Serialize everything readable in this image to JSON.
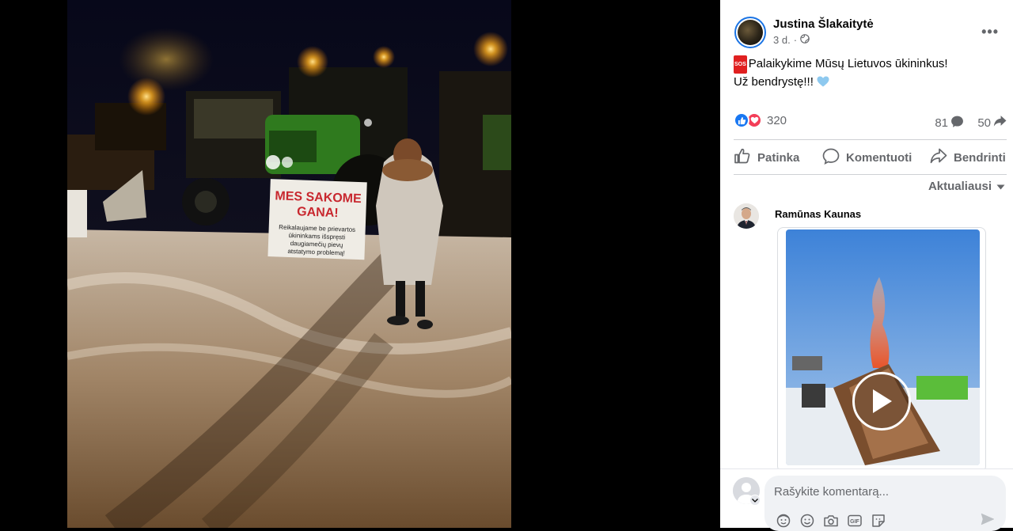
{
  "post": {
    "author": "Justina Šlakaitytė",
    "time": "3 d.",
    "privacy_icon": "globe-icon",
    "more_label": "•••",
    "sos_badge": "SOS",
    "text_line1": "Palaikykime Mūsų Lietuvos ūkininkus!",
    "text_line2": "Už bendrystę!!!",
    "reaction_count": "320",
    "comment_count": "81",
    "share_count": "50"
  },
  "photo": {
    "sign_line1": "MES SAKOME",
    "sign_line2": "GANA!",
    "sign_small1": "Reikalaujame be prievartos",
    "sign_small2": "ūkininkams išspręsti",
    "sign_small3": "daugiamečių pievų",
    "sign_small4": "atstatymo problemą!",
    "left_sign1": "MES",
    "left_sign2": "SAKOME"
  },
  "actions": {
    "like": "Patinka",
    "comment": "Komentuoti",
    "share": "Bendrinti"
  },
  "sort_label": "Aktualiausi",
  "comment": {
    "author": "Ramūnas Kaunas"
  },
  "composer": {
    "placeholder": "Rašykite komentarą..."
  },
  "colors": {
    "accent": "#1877f2",
    "love": "#f33e58",
    "secondary_text": "#65676b"
  }
}
